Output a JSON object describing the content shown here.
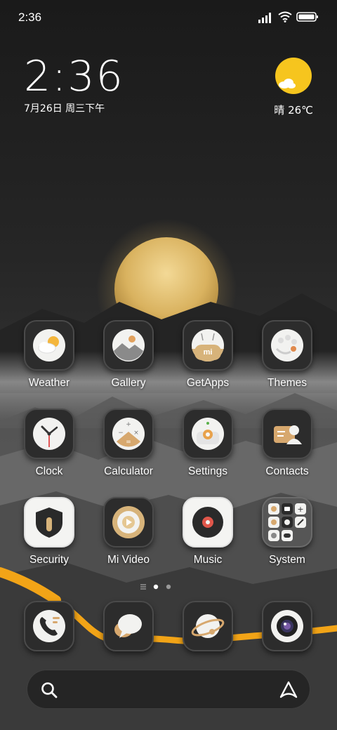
{
  "status_bar": {
    "time": "2:36",
    "icons": [
      "signal-icon",
      "wifi-icon",
      "battery-icon"
    ]
  },
  "clock_widget": {
    "time": "2:36",
    "date": "7月26日 周三下午"
  },
  "weather_widget": {
    "condition_icon": "sun-cloud-icon",
    "text": "晴 26℃"
  },
  "apps": [
    {
      "label": "Weather",
      "icon": "weather-icon"
    },
    {
      "label": "Gallery",
      "icon": "gallery-icon"
    },
    {
      "label": "GetApps",
      "icon": "getapps-icon"
    },
    {
      "label": "Themes",
      "icon": "themes-icon"
    },
    {
      "label": "Clock",
      "icon": "clock-icon"
    },
    {
      "label": "Calculator",
      "icon": "calculator-icon"
    },
    {
      "label": "Settings",
      "icon": "settings-icon"
    },
    {
      "label": "Contacts",
      "icon": "contacts-icon"
    },
    {
      "label": "Security",
      "icon": "security-icon"
    },
    {
      "label": "Mi Video",
      "icon": "mi-video-icon"
    },
    {
      "label": "Music",
      "icon": "music-icon"
    },
    {
      "label": "System",
      "icon": "system-folder-icon"
    }
  ],
  "page_indicator": {
    "pages": 2,
    "current": 1
  },
  "dock": [
    {
      "icon": "phone-icon"
    },
    {
      "icon": "messages-icon"
    },
    {
      "icon": "browser-icon"
    },
    {
      "icon": "camera-icon"
    }
  ],
  "search_bar": {
    "left_icon": "search-icon",
    "right_icon": "assistant-icon"
  },
  "colors": {
    "accent_gold": "#f6c51e",
    "sun_gold": "#d9b25f",
    "river_orange": "#f2a417"
  }
}
